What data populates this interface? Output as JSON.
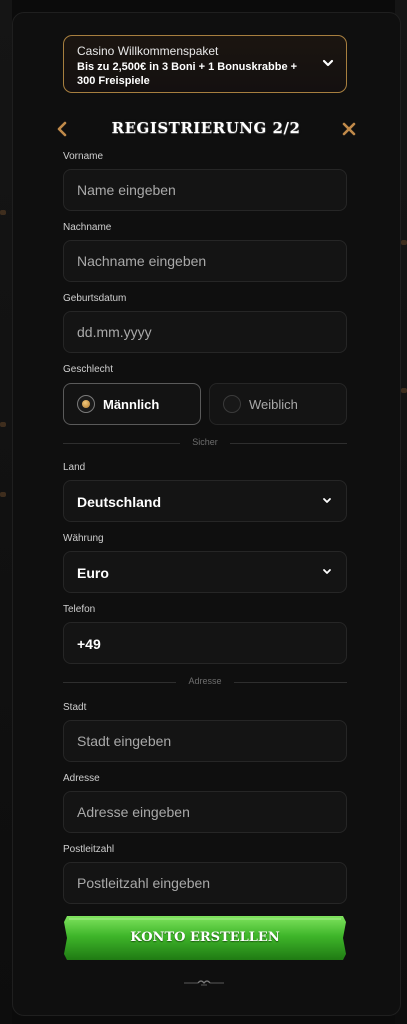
{
  "promo": {
    "title": "Casino Willkommenspaket",
    "text": "Bis zu 2,500€ in 3 Boni + 1 Bonuskrabbe + 300 Freispiele"
  },
  "header": {
    "title": "REGISTRIERUNG 2/2"
  },
  "fields": {
    "first_name": {
      "label": "Vorname",
      "placeholder": "Name eingeben"
    },
    "last_name": {
      "label": "Nachname",
      "placeholder": "Nachname eingeben"
    },
    "birthdate": {
      "label": "Geburtsdatum",
      "placeholder": "dd.mm.yyyy"
    },
    "gender": {
      "label": "Geschlecht",
      "male": "Männlich",
      "female": "Weiblich",
      "selected": "male"
    },
    "country": {
      "label": "Land",
      "value": "Deutschland"
    },
    "currency": {
      "label": "Währung",
      "value": "Euro"
    },
    "phone": {
      "label": "Telefon",
      "value": "+49"
    },
    "city": {
      "label": "Stadt",
      "placeholder": "Stadt eingeben"
    },
    "address": {
      "label": "Adresse",
      "placeholder": "Adresse eingeben"
    },
    "zip": {
      "label": "Postleitzahl",
      "placeholder": "Postleitzahl eingeben"
    }
  },
  "dividers": {
    "secure": "Sicher",
    "address": "Adresse"
  },
  "submit": {
    "label": "KONTO ERSTELLEN"
  },
  "icons": [
    "chevron-down-icon",
    "chevron-left-icon",
    "close-icon",
    "ornament-icon"
  ],
  "colors": {
    "accent": "#c08a4a",
    "cta_green": "#3fb62a",
    "promo_border": "#a77f3f"
  }
}
